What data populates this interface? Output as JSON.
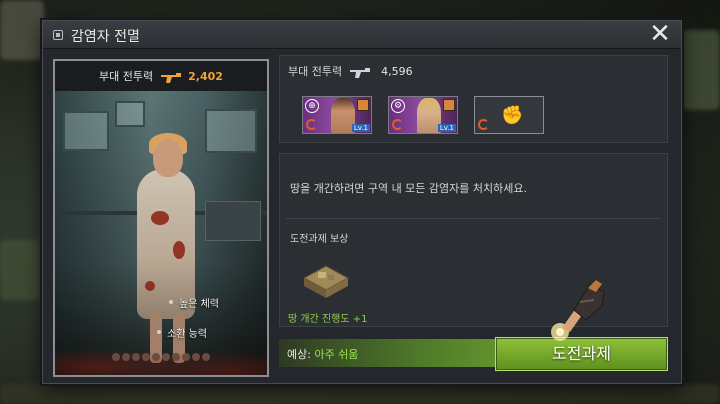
{
  "dialog": {
    "title": "감염자 전멸",
    "close_label": "✕"
  },
  "card": {
    "power_label": "부대 전투력",
    "power_value": "2,402",
    "traits": [
      "높은 체력",
      "소환 능력"
    ],
    "page_dots": 10
  },
  "team": {
    "power_label": "부대 전투력",
    "power_value": "4,596",
    "heroes": [
      {
        "level": "Lv.1",
        "frame": "purple",
        "icon": "crosshair-icon"
      },
      {
        "level": "Lv.1",
        "frame": "purple",
        "icon": "shield-gear-icon"
      },
      {
        "level": "",
        "frame": "empty",
        "icon": "fist-icon"
      }
    ]
  },
  "mission": {
    "description": "땅을 개간하려면 구역 내 모든 감염자를 처치하세요.",
    "reward_title": "도전과제 보상",
    "reward_label": "땅 개간 진행도 +1"
  },
  "footer": {
    "forecast_prefix": "예상: ",
    "forecast_value": "아주 쉬움",
    "challenge_label": "도전과제"
  },
  "colors": {
    "accent_orange": "#f0a23a",
    "accent_green": "#8fc23a",
    "reward_green": "#8fd04a",
    "hero_purple": "#8c4aa0"
  }
}
